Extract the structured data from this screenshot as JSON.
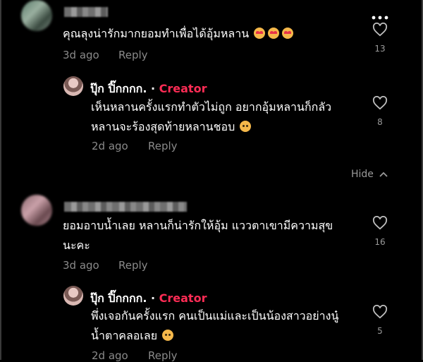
{
  "menu_icon": "more-vertical-icon",
  "comments": [
    {
      "text": "คุณลุงน่ารักมากยอมทำเพื่อได้อุ้มหลาน",
      "emojis": [
        "heart-eyes",
        "heart-eyes",
        "heart-eyes"
      ],
      "age": "3d ago",
      "reply_label": "Reply",
      "likes": "13"
    },
    {
      "text_line1": "ยอมอาบน้ำเลย หลานก็น่ารักให้อุ้ม แววตาเขามีความสุข",
      "text_line2": "นะคะ",
      "age": "3d ago",
      "reply_label": "Reply",
      "likes": "16"
    }
  ],
  "replies": [
    {
      "author": "ปุ๊ก ปิ๊กกกก.",
      "separator": "·",
      "badge": "Creator",
      "text_line1": "เห็นหลานครั้งแรกทำตัวไม่ถูก อยากอุ้มหลานก็กลัว",
      "text_line2": "หลานจะร้องสุดท้ายหลานชอบ",
      "emoji": "sad-face",
      "age": "2d ago",
      "reply_label": "Reply",
      "likes": "8"
    },
    {
      "author": "ปุ๊ก ปิ๊กกกก.",
      "separator": "·",
      "badge": "Creator",
      "text_line1": "พึ่งเจอกันครั้งแรก คนเป็นแม่และเป็นน้องสาวอย่างนู๋",
      "text_line2": "น้ำตาคลอเลย",
      "emoji": "sad-face",
      "age": "2d ago",
      "reply_label": "Reply",
      "likes": "5"
    }
  ],
  "hide_label": "Hide",
  "colors": {
    "creator_badge": "#fe2c55",
    "background": "#000000",
    "muted": "#8a8a8a"
  }
}
